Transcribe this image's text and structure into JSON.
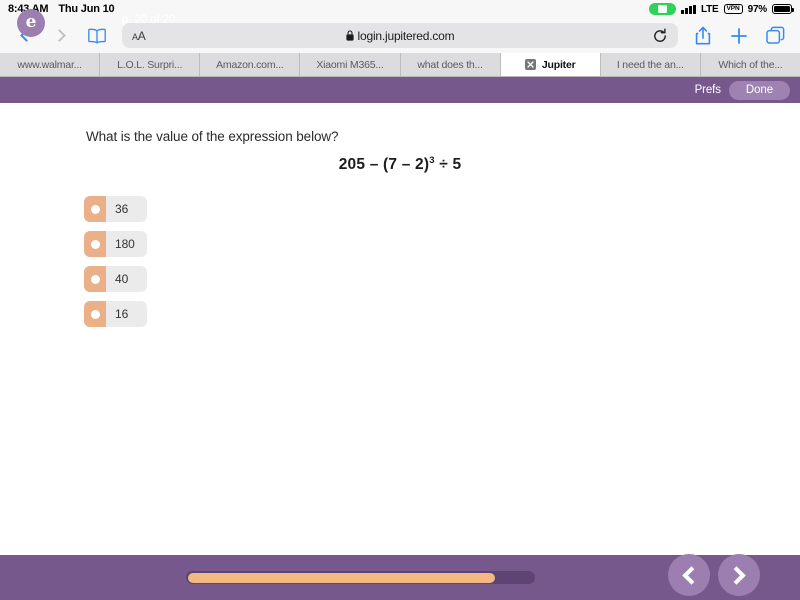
{
  "status_bar": {
    "time": "8:43 AM",
    "date": "Thu Jun 10",
    "recording_icon": "screen-record-indicator",
    "signal_icon": "cellular-signal-icon",
    "network": "LTE",
    "vpn_badge": "VPN",
    "battery_percent": "97%",
    "battery_icon": "battery-icon"
  },
  "browser": {
    "back_icon": "back-chevron-icon",
    "forward_icon": "forward-chevron-icon",
    "bookmarks_icon": "book-icon",
    "text_size_label": "AA",
    "lock_icon": "lock-icon",
    "url": "login.jupitered.com",
    "reload_icon": "reload-icon",
    "share_icon": "share-icon",
    "new_tab_icon": "plus-icon",
    "tabs_icon": "tabs-overview-icon",
    "tabs": [
      {
        "label": "www.walmar...",
        "active": false
      },
      {
        "label": "L.O.L. Surpri...",
        "active": false
      },
      {
        "label": "Amazon.com...",
        "active": false
      },
      {
        "label": "Xiaomi M365...",
        "active": false
      },
      {
        "label": "what does th...",
        "active": false
      },
      {
        "label": "Jupiter",
        "active": true
      },
      {
        "label": "I need the an...",
        "active": false
      },
      {
        "label": "Which of the...",
        "active": false
      }
    ]
  },
  "app_header": {
    "prefs_label": "Prefs",
    "done_label": "Done",
    "background_color": "#77588d"
  },
  "quiz": {
    "question": "What is the value of the expression below?",
    "expression": {
      "base": "205 – (7 – 2)",
      "exponent": "3",
      "tail": " ÷ 5"
    },
    "choices": [
      {
        "label": "36"
      },
      {
        "label": "180"
      },
      {
        "label": "40"
      },
      {
        "label": "16"
      }
    ],
    "bullet_color": "#eab088"
  },
  "footer": {
    "logo_letter": "e",
    "page_label": "p. 20 of 20",
    "progress_percent": 89,
    "prev_icon": "previous-chevron-icon",
    "next_icon": "next-chevron-icon",
    "background_color": "#77588d",
    "progress_color": "#f3b983"
  }
}
